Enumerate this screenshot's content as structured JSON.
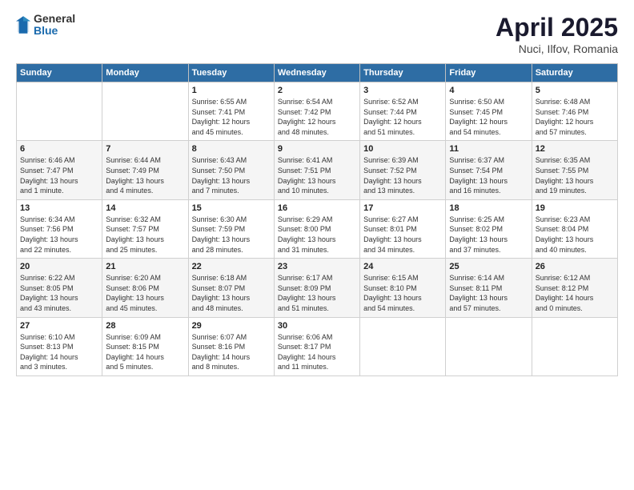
{
  "header": {
    "logo_general": "General",
    "logo_blue": "Blue",
    "title": "April 2025",
    "location": "Nuci, Ilfov, Romania"
  },
  "calendar": {
    "days_of_week": [
      "Sunday",
      "Monday",
      "Tuesday",
      "Wednesday",
      "Thursday",
      "Friday",
      "Saturday"
    ],
    "weeks": [
      [
        {
          "day": "",
          "info": ""
        },
        {
          "day": "",
          "info": ""
        },
        {
          "day": "1",
          "info": "Sunrise: 6:55 AM\nSunset: 7:41 PM\nDaylight: 12 hours\nand 45 minutes."
        },
        {
          "day": "2",
          "info": "Sunrise: 6:54 AM\nSunset: 7:42 PM\nDaylight: 12 hours\nand 48 minutes."
        },
        {
          "day": "3",
          "info": "Sunrise: 6:52 AM\nSunset: 7:44 PM\nDaylight: 12 hours\nand 51 minutes."
        },
        {
          "day": "4",
          "info": "Sunrise: 6:50 AM\nSunset: 7:45 PM\nDaylight: 12 hours\nand 54 minutes."
        },
        {
          "day": "5",
          "info": "Sunrise: 6:48 AM\nSunset: 7:46 PM\nDaylight: 12 hours\nand 57 minutes."
        }
      ],
      [
        {
          "day": "6",
          "info": "Sunrise: 6:46 AM\nSunset: 7:47 PM\nDaylight: 13 hours\nand 1 minute."
        },
        {
          "day": "7",
          "info": "Sunrise: 6:44 AM\nSunset: 7:49 PM\nDaylight: 13 hours\nand 4 minutes."
        },
        {
          "day": "8",
          "info": "Sunrise: 6:43 AM\nSunset: 7:50 PM\nDaylight: 13 hours\nand 7 minutes."
        },
        {
          "day": "9",
          "info": "Sunrise: 6:41 AM\nSunset: 7:51 PM\nDaylight: 13 hours\nand 10 minutes."
        },
        {
          "day": "10",
          "info": "Sunrise: 6:39 AM\nSunset: 7:52 PM\nDaylight: 13 hours\nand 13 minutes."
        },
        {
          "day": "11",
          "info": "Sunrise: 6:37 AM\nSunset: 7:54 PM\nDaylight: 13 hours\nand 16 minutes."
        },
        {
          "day": "12",
          "info": "Sunrise: 6:35 AM\nSunset: 7:55 PM\nDaylight: 13 hours\nand 19 minutes."
        }
      ],
      [
        {
          "day": "13",
          "info": "Sunrise: 6:34 AM\nSunset: 7:56 PM\nDaylight: 13 hours\nand 22 minutes."
        },
        {
          "day": "14",
          "info": "Sunrise: 6:32 AM\nSunset: 7:57 PM\nDaylight: 13 hours\nand 25 minutes."
        },
        {
          "day": "15",
          "info": "Sunrise: 6:30 AM\nSunset: 7:59 PM\nDaylight: 13 hours\nand 28 minutes."
        },
        {
          "day": "16",
          "info": "Sunrise: 6:29 AM\nSunset: 8:00 PM\nDaylight: 13 hours\nand 31 minutes."
        },
        {
          "day": "17",
          "info": "Sunrise: 6:27 AM\nSunset: 8:01 PM\nDaylight: 13 hours\nand 34 minutes."
        },
        {
          "day": "18",
          "info": "Sunrise: 6:25 AM\nSunset: 8:02 PM\nDaylight: 13 hours\nand 37 minutes."
        },
        {
          "day": "19",
          "info": "Sunrise: 6:23 AM\nSunset: 8:04 PM\nDaylight: 13 hours\nand 40 minutes."
        }
      ],
      [
        {
          "day": "20",
          "info": "Sunrise: 6:22 AM\nSunset: 8:05 PM\nDaylight: 13 hours\nand 43 minutes."
        },
        {
          "day": "21",
          "info": "Sunrise: 6:20 AM\nSunset: 8:06 PM\nDaylight: 13 hours\nand 45 minutes."
        },
        {
          "day": "22",
          "info": "Sunrise: 6:18 AM\nSunset: 8:07 PM\nDaylight: 13 hours\nand 48 minutes."
        },
        {
          "day": "23",
          "info": "Sunrise: 6:17 AM\nSunset: 8:09 PM\nDaylight: 13 hours\nand 51 minutes."
        },
        {
          "day": "24",
          "info": "Sunrise: 6:15 AM\nSunset: 8:10 PM\nDaylight: 13 hours\nand 54 minutes."
        },
        {
          "day": "25",
          "info": "Sunrise: 6:14 AM\nSunset: 8:11 PM\nDaylight: 13 hours\nand 57 minutes."
        },
        {
          "day": "26",
          "info": "Sunrise: 6:12 AM\nSunset: 8:12 PM\nDaylight: 14 hours\nand 0 minutes."
        }
      ],
      [
        {
          "day": "27",
          "info": "Sunrise: 6:10 AM\nSunset: 8:13 PM\nDaylight: 14 hours\nand 3 minutes."
        },
        {
          "day": "28",
          "info": "Sunrise: 6:09 AM\nSunset: 8:15 PM\nDaylight: 14 hours\nand 5 minutes."
        },
        {
          "day": "29",
          "info": "Sunrise: 6:07 AM\nSunset: 8:16 PM\nDaylight: 14 hours\nand 8 minutes."
        },
        {
          "day": "30",
          "info": "Sunrise: 6:06 AM\nSunset: 8:17 PM\nDaylight: 14 hours\nand 11 minutes."
        },
        {
          "day": "",
          "info": ""
        },
        {
          "day": "",
          "info": ""
        },
        {
          "day": "",
          "info": ""
        }
      ]
    ]
  }
}
